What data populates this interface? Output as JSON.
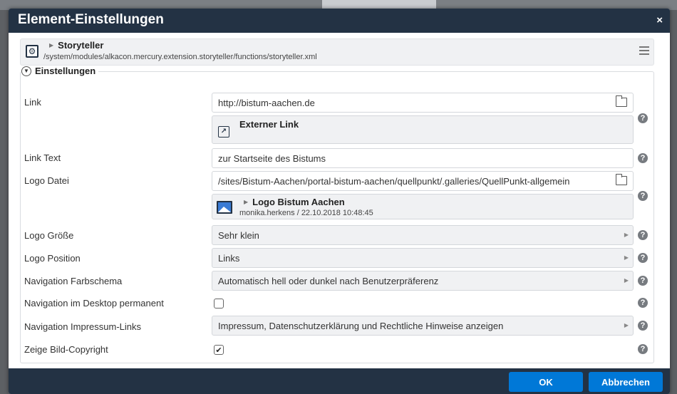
{
  "dialog": {
    "title": "Element-Einstellungen",
    "close": "×"
  },
  "resource": {
    "title": "Storyteller",
    "path": "/system/modules/alkacon.mercury.extension.storyteller/functions/storyteller.xml"
  },
  "section": {
    "legend": "Einstellungen"
  },
  "fields": {
    "link": {
      "label": "Link",
      "value": "http://bistum-aachen.de",
      "type_label": "Externer Link"
    },
    "link_text": {
      "label": "Link Text",
      "value": "zur Startseite des Bistums"
    },
    "logo_datei": {
      "label": "Logo Datei",
      "value": "/sites/Bistum-Aachen/portal-bistum-aachen/quellpunkt/.galleries/QuellPunkt-allgemein",
      "preview_title": "Logo Bistum Aachen",
      "preview_meta": "monika.herkens / 22.10.2018 10:48:45"
    },
    "logo_groesse": {
      "label": "Logo Größe",
      "value": "Sehr klein"
    },
    "logo_position": {
      "label": "Logo Position",
      "value": "Links"
    },
    "nav_farbschema": {
      "label": "Navigation Farbschema",
      "value": "Automatisch hell oder dunkel nach Benutzerpräferenz"
    },
    "nav_desktop": {
      "label": "Navigation im Desktop permanent",
      "checked": false
    },
    "nav_impressum": {
      "label": "Navigation Impressum-Links",
      "value": "Impressum, Datenschutzerklärung und Rechtliche Hinweise anzeigen"
    },
    "bild_copyright": {
      "label": "Zeige Bild-Copyright",
      "checked": true,
      "check_mark": "✔"
    }
  },
  "help_glyph": "?",
  "buttons": {
    "ok": "OK",
    "cancel": "Abbrechen"
  },
  "colors": {
    "titlebar": "#233244",
    "button": "#0078d7",
    "field_bg": "#f0f1f3"
  },
  "icons": [
    "gear-icon",
    "menu-icon",
    "folder-icon",
    "external-link-icon",
    "image-icon",
    "help-icon",
    "chevron-right-icon"
  ]
}
